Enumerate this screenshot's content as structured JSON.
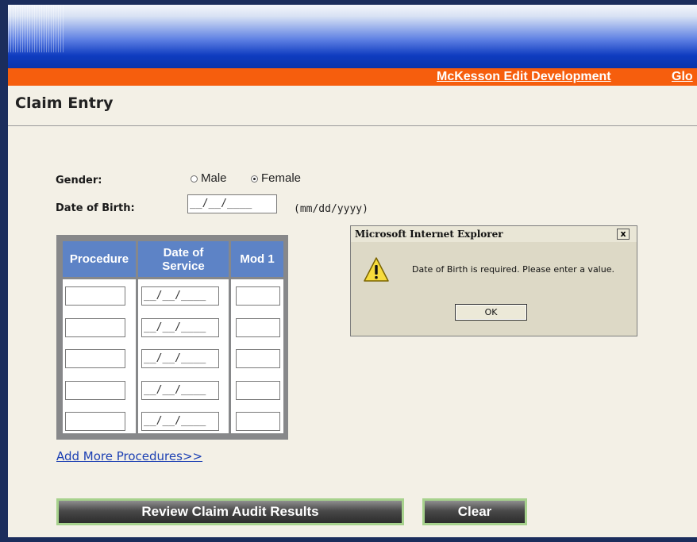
{
  "header": {
    "nav_links": [
      "McKesson Edit Development",
      "Glo"
    ]
  },
  "page": {
    "title": "Claim Entry"
  },
  "form": {
    "gender_label": "Gender:",
    "gender_options": [
      "Male",
      "Female"
    ],
    "gender_selected": "Female",
    "dob_label": "Date of Birth:",
    "dob_value": "__/__/____",
    "dob_hint": "(mm/dd/yyyy)"
  },
  "procedures": {
    "columns": [
      "Procedure",
      "Date of Service",
      "Mod 1"
    ],
    "date_placeholder": "__/__/____",
    "rows": [
      {
        "procedure": "",
        "date": "__/__/____",
        "mod1": ""
      },
      {
        "procedure": "",
        "date": "__/__/____",
        "mod1": ""
      },
      {
        "procedure": "",
        "date": "__/__/____",
        "mod1": ""
      },
      {
        "procedure": "",
        "date": "__/__/____",
        "mod1": ""
      },
      {
        "procedure": "",
        "date": "__/__/____",
        "mod1": ""
      }
    ],
    "add_more_label": "Add More Procedures>>"
  },
  "actions": {
    "review_label": "Review Claim Audit Results",
    "clear_label": "Clear"
  },
  "dialog": {
    "title": "Microsoft Internet Explorer",
    "close_label": "x",
    "icon": "warning-icon",
    "message": "Date of Birth is required. Please enter a value.",
    "ok_label": "OK"
  },
  "colors": {
    "orange_bar": "#f65e0d",
    "header_blue": "#0f3cc0",
    "table_header": "#5d83c6",
    "link": "#1b3fb3"
  }
}
